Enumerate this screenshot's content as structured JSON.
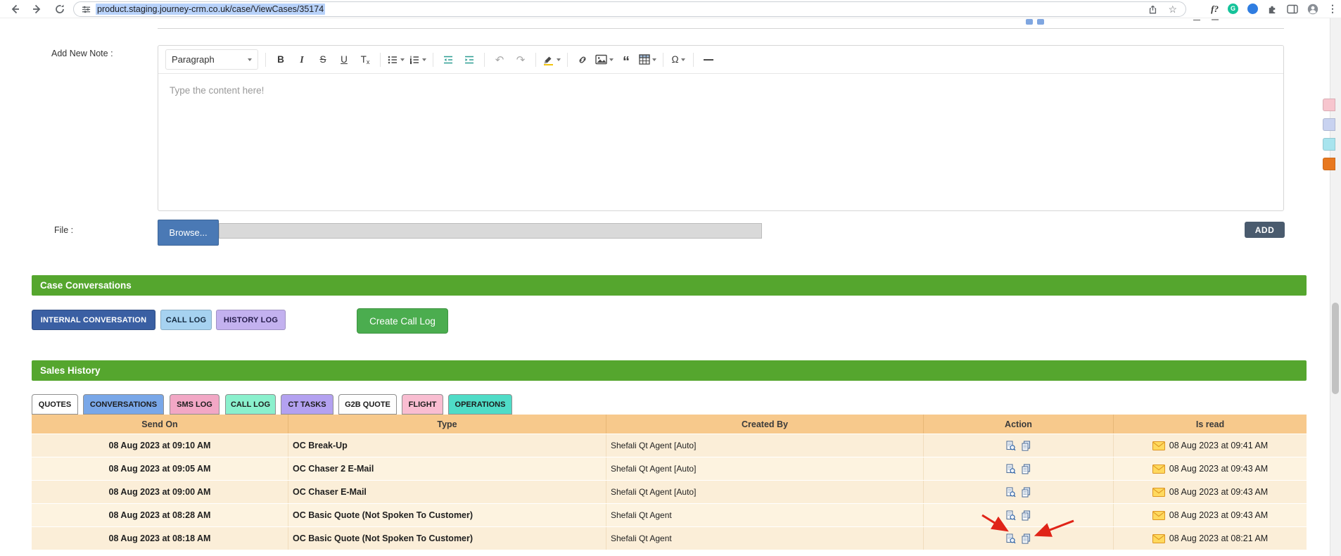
{
  "browser": {
    "url": "product.staging.journey-crm.co.uk/case/ViewCases/35174",
    "star_glyph": "☆",
    "fonts_ext_glyph": "f?",
    "grammarly_glyph": "G",
    "menu_glyph": "⋮"
  },
  "note_form": {
    "label": "Add New Note :",
    "file_label": "File :",
    "browse_button": "Browse...",
    "add_button": "ADD"
  },
  "editor": {
    "paragraph_select": "Paragraph",
    "placeholder": "Type the content here!",
    "bold_glyph": "B",
    "italic_glyph": "I",
    "strike_glyph": "S",
    "underline_glyph": "U",
    "remove_format_main": "T",
    "remove_format_sub": "x",
    "undo_glyph": "↶",
    "redo_glyph": "↷",
    "blockquote_glyph": "“",
    "special_char_glyph": "Ω"
  },
  "case_conversations": {
    "title": "Case Conversations",
    "buttons": [
      {
        "label": "INTERNAL CONVERSATION"
      },
      {
        "label": "CALL LOG"
      },
      {
        "label": "HISTORY LOG"
      }
    ],
    "create_call_log_button": "Create Call Log"
  },
  "sales_history": {
    "title": "Sales History",
    "tabs": [
      {
        "label": "QUOTES",
        "active": true
      },
      {
        "label": "CONVERSATIONS",
        "active": false
      },
      {
        "label": "SMS LOG",
        "active": false
      },
      {
        "label": "CALL LOG",
        "active": false
      },
      {
        "label": "CT TASKS",
        "active": false
      },
      {
        "label": "G2B QUOTE",
        "active": false
      },
      {
        "label": "FLIGHT",
        "active": false
      },
      {
        "label": "OPERATIONS",
        "active": false
      }
    ],
    "table": {
      "headers": [
        "Send On",
        "Type",
        "Created By",
        "Action",
        "Is read"
      ],
      "rows": [
        {
          "send_on": "08 Aug 2023 at 09:10 AM",
          "type": "OC Break-Up",
          "created_by": "Shefali Qt Agent [Auto]",
          "is_read": "08 Aug 2023 at 09:41 AM"
        },
        {
          "send_on": "08 Aug 2023 at 09:05 AM",
          "type": "OC Chaser 2 E-Mail",
          "created_by": "Shefali Qt Agent [Auto]",
          "is_read": "08 Aug 2023 at 09:43 AM"
        },
        {
          "send_on": "08 Aug 2023 at 09:00 AM",
          "type": "OC Chaser E-Mail",
          "created_by": "Shefali Qt Agent [Auto]",
          "is_read": "08 Aug 2023 at 09:43 AM"
        },
        {
          "send_on": "08 Aug 2023 at 08:28 AM",
          "type": "OC Basic Quote (Not Spoken To Customer)",
          "created_by": "Shefali Qt Agent",
          "is_read": "08 Aug 2023 at 09:43 AM"
        },
        {
          "send_on": "08 Aug 2023 at 08:18 AM",
          "type": "OC Basic Quote (Not Spoken To Customer)",
          "created_by": "Shefali Qt Agent",
          "is_read": "08 Aug 2023 at 08:21 AM"
        }
      ]
    }
  },
  "annotation": {
    "arrow_color": "#e02418"
  },
  "colors": {
    "section_bar_green": "#55a62e",
    "table_header_orange": "#f7c98c",
    "row_cream": "#fdf3e0",
    "internal_conversation_blue": "#3a5fa3",
    "call_log_light_blue": "#a6d2f0",
    "history_log_lavender": "#c3b1ef",
    "create_call_log_green": "#4bad4f",
    "browse_blue": "#4a79b5",
    "add_button_slate": "#4a5b6e",
    "url_selection": "#b8d2fa"
  }
}
